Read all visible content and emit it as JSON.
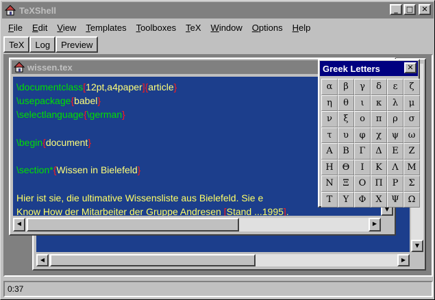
{
  "app": {
    "title": "TeXShell"
  },
  "window_controls": {
    "minimize": "_",
    "maximize": "□",
    "close": "✕"
  },
  "menu": [
    {
      "label": "File",
      "accel": "F",
      "rest": "ile"
    },
    {
      "label": "Edit",
      "accel": "E",
      "rest": "dit"
    },
    {
      "label": "View",
      "accel": "V",
      "rest": "iew"
    },
    {
      "label": "Templates",
      "accel": "T",
      "rest": "emplates"
    },
    {
      "label": "Toolboxes",
      "accel": "T",
      "rest": "oolboxes"
    },
    {
      "label": "TeX",
      "accel": "T",
      "rest": "eX"
    },
    {
      "label": "Window",
      "accel": "W",
      "rest": "indow"
    },
    {
      "label": "Options",
      "accel": "O",
      "rest": "ptions"
    },
    {
      "label": "Help",
      "accel": "H",
      "rest": "elp"
    }
  ],
  "tabs": [
    "TeX",
    "Log",
    "Preview"
  ],
  "editor": {
    "filename": "wissen.tex",
    "lines": [
      [
        {
          "t": "\\documentclass",
          "c": "cmd"
        },
        {
          "t": "[",
          "c": "br"
        },
        {
          "t": "12pt,a4paper",
          "c": "arg"
        },
        {
          "t": "]{",
          "c": "br"
        },
        {
          "t": "article",
          "c": "arg"
        },
        {
          "t": "}",
          "c": "br"
        }
      ],
      [
        {
          "t": "\\usepackage",
          "c": "cmd"
        },
        {
          "t": "{",
          "c": "br"
        },
        {
          "t": "babel",
          "c": "arg"
        },
        {
          "t": "}",
          "c": "br"
        }
      ],
      [
        {
          "t": "\\selectlanguage",
          "c": "cmd"
        },
        {
          "t": "{",
          "c": "br"
        },
        {
          "t": "\\german",
          "c": "cmd"
        },
        {
          "t": "}",
          "c": "br"
        }
      ],
      [],
      [
        {
          "t": "\\begin",
          "c": "cmd"
        },
        {
          "t": "{",
          "c": "br"
        },
        {
          "t": "document",
          "c": "arg"
        },
        {
          "t": "}",
          "c": "br"
        }
      ],
      [],
      [
        {
          "t": "\\section*",
          "c": "cmd"
        },
        {
          "t": "{",
          "c": "br"
        },
        {
          "t": "Wissen in Bielefeld",
          "c": "arg"
        },
        {
          "t": "}",
          "c": "br"
        }
      ],
      [],
      [
        {
          "t": "Hier ist sie, die ultimative Wissensliste aus Bielefeld. Sie e",
          "c": "text"
        }
      ],
      [
        {
          "t": "Know How der Mitarbeiter der Gruppe Andresen ",
          "c": "text"
        },
        {
          "t": "[",
          "c": "br"
        },
        {
          "t": "Stand ...1995",
          "c": "text"
        },
        {
          "t": "]",
          "c": "br"
        },
        {
          "t": ".",
          "c": "text"
        }
      ]
    ]
  },
  "greek_palette": {
    "title": "Greek Letters",
    "close": "✕",
    "letters": [
      "α",
      "β",
      "γ",
      "δ",
      "ε",
      "ζ",
      "η",
      "θ",
      "ι",
      "κ",
      "λ",
      "μ",
      "ν",
      "ξ",
      "ο",
      "π",
      "ρ",
      "σ",
      "τ",
      "υ",
      "φ",
      "χ",
      "ψ",
      "ω",
      "Α",
      "Β",
      "Γ",
      "Δ",
      "Ε",
      "Ζ",
      "Η",
      "Θ",
      "Ι",
      "Κ",
      "Λ",
      "Μ",
      "Ν",
      "Ξ",
      "Ο",
      "Π",
      "Ρ",
      "Σ",
      "Τ",
      "Υ",
      "Φ",
      "Χ",
      "Ψ",
      "Ω"
    ]
  },
  "statusbar": {
    "time": "0:37"
  },
  "colors": {
    "editor_bg": "#1c3e8c",
    "command": "#00e000",
    "bracket": "#ff1a1a",
    "argument": "#ffff7a",
    "palette_title": "#000080"
  },
  "icons": {
    "app": "house-icon",
    "document": "document-icon",
    "scroll_up": "arrow-up-icon",
    "scroll_down": "arrow-down-icon",
    "scroll_left": "arrow-left-icon",
    "scroll_right": "arrow-right-icon"
  }
}
